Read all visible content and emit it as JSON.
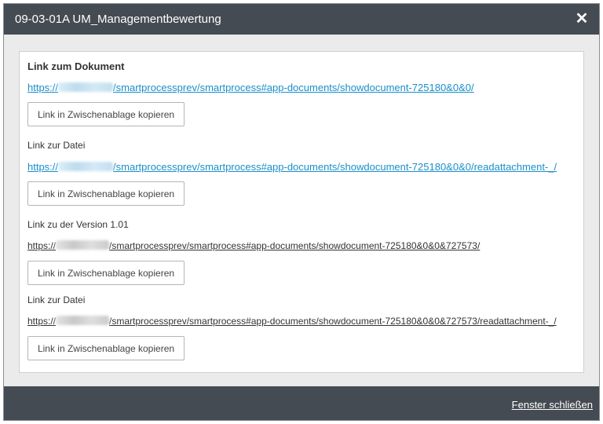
{
  "dialog": {
    "title": "09-03-01A UM_Managementbewertung",
    "close_symbol": "✕"
  },
  "sections": [
    {
      "title": "Link zum Dokument",
      "link_prefix": "https://",
      "link_suffix": "/smartprocessprev/smartprocess#app-documents/showdocument-725180&0&0/",
      "button_label": "Link in Zwischenablage kopieren"
    },
    {
      "title": "Link zur Datei",
      "link_prefix": "https://",
      "link_suffix": "/smartprocessprev/smartprocess#app-documents/showdocument-725180&0&0/readattachment-_/",
      "button_label": "Link in Zwischenablage kopieren"
    },
    {
      "title": "Link zu der Version 1.01",
      "link_prefix": "https://",
      "link_suffix": "/smartprocessprev/smartprocess#app-documents/showdocument-725180&0&0&727573/",
      "button_label": "Link in Zwischenablage kopieren"
    },
    {
      "title": "Link zur Datei",
      "link_prefix": "https://",
      "link_suffix": "/smartprocessprev/smartprocess#app-documents/showdocument-725180&0&0&727573/readattachment-_/",
      "button_label": "Link in Zwischenablage kopieren"
    }
  ],
  "footer": {
    "close_label": "Fenster schließen"
  },
  "colors": {
    "header_bg": "#454b52",
    "link_primary": "#1a8fc8",
    "link_secondary": "#333333"
  }
}
